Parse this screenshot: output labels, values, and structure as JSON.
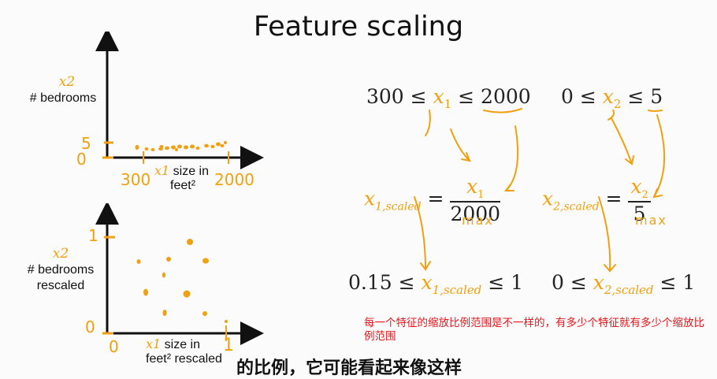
{
  "title": "Feature scaling",
  "plot1": {
    "y_var": "x2",
    "y_label": "# bedrooms",
    "y_tick_5": "5",
    "y_tick_0": "0",
    "x_tick_300": "300",
    "x_tick_2000": "2000",
    "x_var": "x1",
    "x_label_line1": "size in",
    "x_label_line2": "feet²"
  },
  "plot2": {
    "y_var": "x2",
    "y_label_line1": "# bedrooms",
    "y_label_line2": "rescaled",
    "y_tick_1": "1",
    "y_tick_0": "0",
    "x_tick_0": "0",
    "x_tick_1": "1",
    "x_var": "x1",
    "x_label_line1": "size in",
    "x_label_line2": "feet² rescaled"
  },
  "math": {
    "range1_low": "300 ≤ ",
    "range1_var": "x",
    "range1_sub": "1",
    "range1_high": " ≤ 2000",
    "range2_low": "0 ≤ ",
    "range2_var": "x",
    "range2_sub": "2",
    "range2_high": " ≤ 5",
    "scaled1_var": "x",
    "scaled1_sub": "1,scaled",
    "scaled1_num_var": "x",
    "scaled1_num_sub": "1",
    "scaled1_den": "2000",
    "scaled2_var": "x",
    "scaled2_sub": "2,scaled",
    "scaled2_num_var": "x",
    "scaled2_num_sub": "2",
    "scaled2_den": "5",
    "max1": "max",
    "max2": "max",
    "result1_low": "0.15 ≤ ",
    "result1_var": "x",
    "result1_sub": "1,scaled",
    "result1_high": " ≤ 1",
    "result2_low": "0 ≤ ",
    "result2_var": "x",
    "result2_sub": "2,scaled",
    "result2_high": " ≤ 1"
  },
  "note": "每一个特征的缩放比例范围是不一样的，有多少个特征就有多少个缩放比例范围",
  "subtitle_partial": "的比例，它可能看起来像这样"
}
